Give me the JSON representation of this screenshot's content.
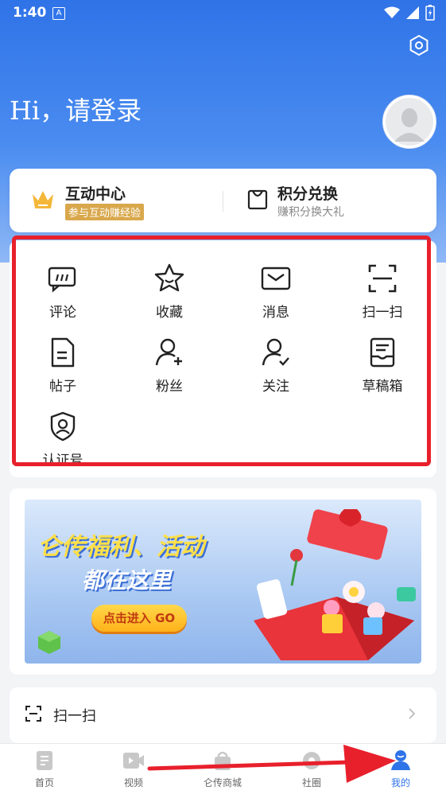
{
  "status_bar": {
    "time": "1:40",
    "notification_glyph": "A"
  },
  "header": {
    "greeting": "Hi，请登录"
  },
  "top_cards": {
    "interaction": {
      "title": "互动中心",
      "badge": "参与互动赚经验"
    },
    "points": {
      "title": "积分兑换",
      "subtitle": "赚积分换大礼"
    }
  },
  "grid": {
    "items": [
      {
        "label": "评论",
        "icon": "comment-icon"
      },
      {
        "label": "收藏",
        "icon": "star-icon"
      },
      {
        "label": "消息",
        "icon": "mail-icon"
      },
      {
        "label": "扫一扫",
        "icon": "scan-icon"
      },
      {
        "label": "帖子",
        "icon": "post-icon"
      },
      {
        "label": "粉丝",
        "icon": "fans-icon"
      },
      {
        "label": "关注",
        "icon": "follow-icon"
      },
      {
        "label": "草稿箱",
        "icon": "drafts-icon"
      },
      {
        "label": "认证号",
        "icon": "verified-icon"
      }
    ]
  },
  "banner": {
    "line1": "仑传福利、活动",
    "line2": "都在这里",
    "button": "点击进入 GO"
  },
  "scan_row": {
    "label": "扫一扫"
  },
  "bottom_nav": {
    "items": [
      {
        "label": "首页",
        "icon": "home-icon"
      },
      {
        "label": "视频",
        "icon": "video-icon"
      },
      {
        "label": "仑传商城",
        "icon": "shop-icon"
      },
      {
        "label": "社圈",
        "icon": "community-icon"
      },
      {
        "label": "我的",
        "icon": "profile-icon"
      }
    ],
    "active": "我的"
  },
  "colors": {
    "primary": "#2f73e8",
    "annotation_red": "#e8202c",
    "badge_gold": "#d9a84c"
  }
}
